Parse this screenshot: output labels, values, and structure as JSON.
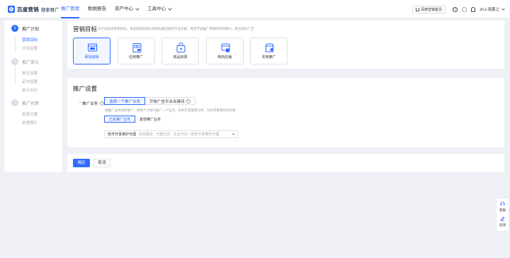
{
  "app": {
    "logo_brand": "百度营销",
    "logo_sub": "搜索推广",
    "brand_color": "#2f6bff"
  },
  "nav": {
    "items": [
      {
        "label": "推广管理",
        "active": true,
        "has_dropdown": false
      },
      {
        "label": "数据报告",
        "active": false,
        "has_dropdown": false
      },
      {
        "label": "资产中心",
        "active": false,
        "has_dropdown": true
      },
      {
        "label": "工具中心",
        "active": false,
        "has_dropdown": true
      }
    ]
  },
  "top_right": {
    "compare_btn": "百度营销首页",
    "help_icon": "question-circle-icon",
    "settings_icon": "gear-icon",
    "notice_icon": "bell-icon",
    "user": "zh上海黄之"
  },
  "sidebar": {
    "steps": [
      {
        "num": "1",
        "label": "推广计划",
        "active": true,
        "subs": [
          {
            "label": "营销目标",
            "active": true
          },
          {
            "label": "计划设置",
            "active": false
          }
        ]
      },
      {
        "num": "2",
        "label": "推广单元",
        "active": false,
        "subs": [
          {
            "label": "单元设置",
            "active": false
          },
          {
            "label": "定向设置",
            "active": false
          },
          {
            "label": "单元出价",
            "active": false
          }
        ]
      },
      {
        "num": "3",
        "label": "推广创意",
        "active": false,
        "subs": [
          {
            "label": "创意文案",
            "active": false
          },
          {
            "label": "创意图片",
            "active": false
          }
        ]
      }
    ]
  },
  "marketing_goal": {
    "title": "营销目标",
    "description": "为计划选择营销目标，系统帮您找到达成目标最匹配的产品功能，帮您节省推广营销时间和精力，更出色的广告",
    "cards": [
      {
        "label": "网站链接",
        "icon": "website-link-icon",
        "selected": true
      },
      {
        "label": "应用推广",
        "icon": "app-promotion-icon",
        "selected": false
      },
      {
        "label": "商品目录",
        "icon": "product-catalog-icon",
        "selected": false
      },
      {
        "label": "电商店铺",
        "icon": "ecommerce-store-icon",
        "selected": false
      },
      {
        "label": "本地推广",
        "icon": "local-promotion-icon",
        "selected": false
      }
    ]
  },
  "promo_settings": {
    "title": "推广设置",
    "business_label": "推广业务",
    "business_required": "*",
    "mode_options": [
      {
        "label": "选择一个推广业务",
        "selected": true
      },
      {
        "label": "开放广告平台关键词",
        "selected": false
      }
    ],
    "hint": "按推广业务组织账户，即每个计划只推广一个业务，有利于管理和分析，为您带来更好的效果",
    "scope_options": [
      {
        "label": "已有推广业务",
        "selected": true
      },
      {
        "label": "其他推广业务",
        "selected": false
      }
    ],
    "business_select": {
      "value": "软件开发维护代理",
      "path": "商务服务 - 代理代办 - 企业代办 - 软件开发维护代理"
    }
  },
  "actions": {
    "confirm": "确定",
    "cancel": "取消"
  },
  "float_tools": [
    {
      "label": "客服",
      "icon": "headset-icon"
    },
    {
      "label": "反馈",
      "icon": "pen-icon"
    }
  ]
}
